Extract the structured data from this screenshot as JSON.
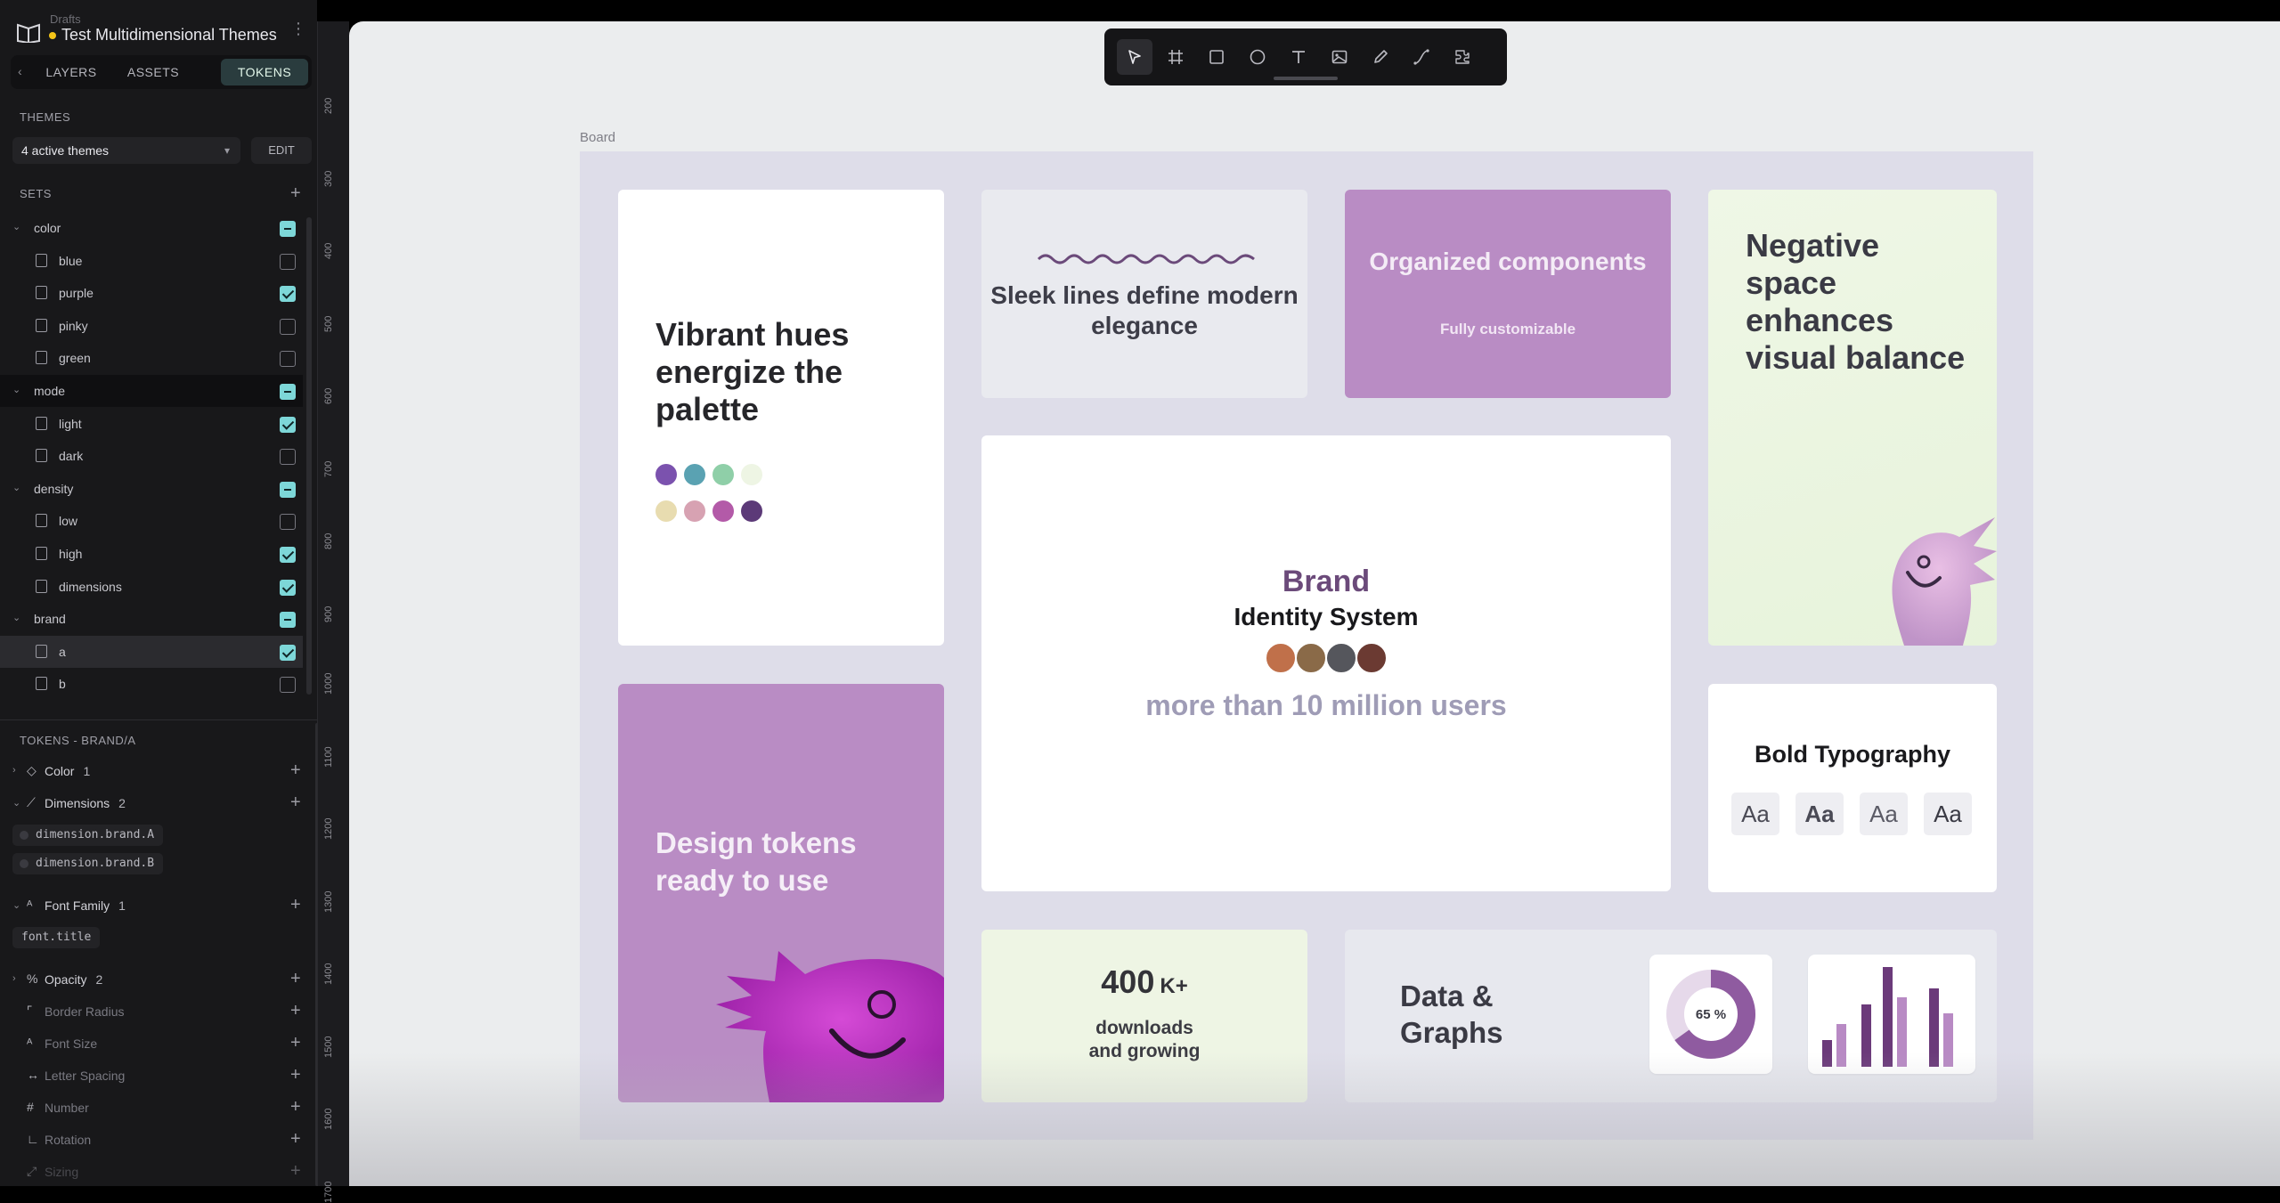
{
  "file": {
    "subtitle": "Drafts",
    "title": "Test Multidimensional Themes",
    "unsaved_dot_color": "#f5c518"
  },
  "tabs": [
    {
      "label": "LAYERS",
      "active": false
    },
    {
      "label": "ASSETS",
      "active": false
    },
    {
      "label": "TOKENS",
      "active": true
    }
  ],
  "themes": {
    "label": "THEMES",
    "selected": "4 active themes",
    "edit_label": "EDIT"
  },
  "sets": {
    "label": "SETS",
    "rows": [
      {
        "name": "color",
        "kind": "group",
        "state": "partial"
      },
      {
        "name": "blue",
        "kind": "set",
        "state": "off"
      },
      {
        "name": "purple",
        "kind": "set",
        "state": "on"
      },
      {
        "name": "pinky",
        "kind": "set",
        "state": "off"
      },
      {
        "name": "green",
        "kind": "set",
        "state": "off"
      },
      {
        "name": "mode",
        "kind": "group",
        "state": "partial"
      },
      {
        "name": "light",
        "kind": "set",
        "state": "on"
      },
      {
        "name": "dark",
        "kind": "set",
        "state": "off"
      },
      {
        "name": "density",
        "kind": "group",
        "state": "partial"
      },
      {
        "name": "low",
        "kind": "set",
        "state": "off"
      },
      {
        "name": "high",
        "kind": "set",
        "state": "on"
      },
      {
        "name": "dimensions",
        "kind": "set",
        "state": "on"
      },
      {
        "name": "brand",
        "kind": "group",
        "state": "partial"
      },
      {
        "name": "a",
        "kind": "set",
        "state": "on"
      },
      {
        "name": "b",
        "kind": "set",
        "state": "off"
      }
    ]
  },
  "tokens": {
    "label": "TOKENS - BRAND/A",
    "groups": [
      {
        "name": "Color",
        "count": "1",
        "icon": "droplet-icon"
      },
      {
        "name": "Dimensions",
        "count": "2",
        "icon": "ruler-icon"
      },
      {
        "name": "Font Family",
        "count": "1",
        "icon": "font-icon"
      },
      {
        "name": "Opacity",
        "count": "2",
        "icon": "percent-icon"
      },
      {
        "name": "Border Radius",
        "count": "",
        "icon": "radius-icon"
      },
      {
        "name": "Font Size",
        "count": "",
        "icon": "font-size-icon"
      },
      {
        "name": "Letter Spacing",
        "count": "",
        "icon": "letter-spacing-icon"
      },
      {
        "name": "Number",
        "count": "",
        "icon": "number-icon"
      },
      {
        "name": "Rotation",
        "count": "",
        "icon": "rotation-icon"
      },
      {
        "name": "Sizing",
        "count": "",
        "icon": "sizing-icon"
      }
    ],
    "dimension_pills": [
      "dimension.brand.A",
      "dimension.brand.B"
    ],
    "font_pills": [
      "font.title"
    ]
  },
  "ruler": [
    "200",
    "300",
    "400",
    "500",
    "600",
    "700",
    "800",
    "900",
    "1000",
    "1100",
    "1200",
    "1300",
    "1400",
    "1500",
    "1600",
    "1700"
  ],
  "toolbar": {
    "tools": [
      "pointer-icon",
      "board-icon",
      "rectangle-icon",
      "ellipse-icon",
      "text-icon",
      "image-icon",
      "pencil-icon",
      "path-icon",
      "plugins-icon"
    ],
    "active_tool": "pointer-icon"
  },
  "board": {
    "label": "Board",
    "vibrant": {
      "title": "Vibrant hues energize the palette",
      "swatches": [
        "#7b52ae",
        "#5aa2b2",
        "#8fcfa8",
        "#eef5e4",
        "#e8dcb0",
        "#d7a2b2",
        "#b35aa8",
        "#5c3a78"
      ]
    },
    "sleek": {
      "title": "Sleek lines define modern elegance"
    },
    "organized": {
      "title": "Organized components",
      "subtitle": "Fully customizable"
    },
    "negative": {
      "title": "Negative space enhances visual balance"
    },
    "brand": {
      "title": "Brand",
      "subtitle": "Identity System",
      "tagline": "more than 10 million users"
    },
    "design": {
      "title": "Design tokens ready to use"
    },
    "bold": {
      "title": "Bold Typography",
      "samples": [
        "Aa",
        "Aa",
        "Aa",
        "Aa"
      ]
    },
    "downloads": {
      "number": "400",
      "suffix": "K+",
      "caption": "downloads and growing"
    },
    "data": {
      "title": "Data & Graphs",
      "donut_label": "65 %",
      "donut_fraction": 0.65
    }
  },
  "colors": {
    "accent_teal": "#7dd7d8",
    "purple_card": "#b98cc4",
    "brand_purple": "#6b4a7a"
  }
}
